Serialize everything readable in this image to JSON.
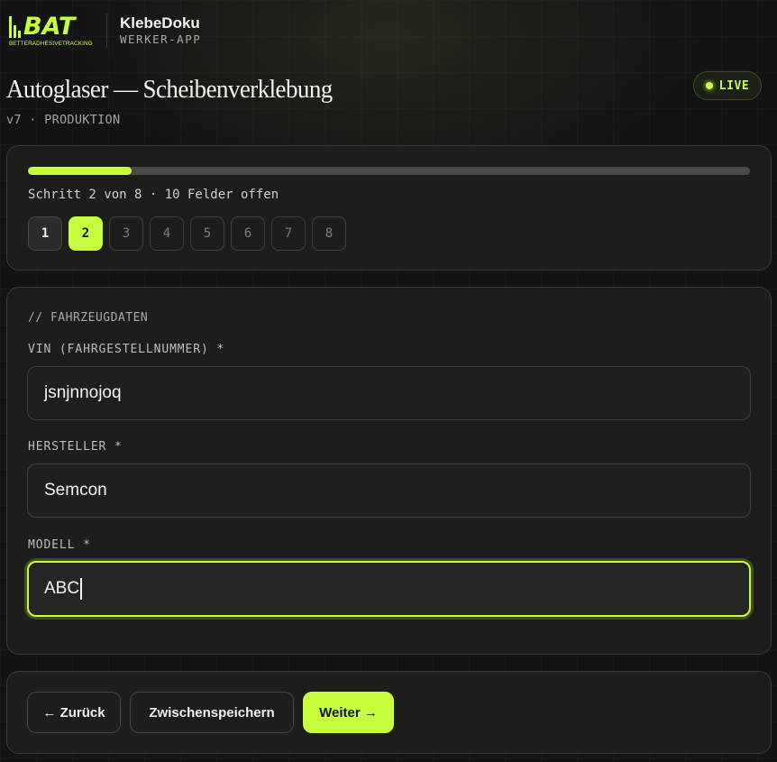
{
  "brand": {
    "logo_text": "BAT",
    "logo_tagline": "BETTERADHESIVETRACKING",
    "app_name": "KlebeDoku",
    "app_subtitle": "WERKER-APP",
    "accent_color": "#c6ff3d"
  },
  "page": {
    "title": "Autoglaser — Scheibenverklebung",
    "meta": "v7 · PRODUKTION",
    "status_badge": "LIVE"
  },
  "progress": {
    "current_step": 2,
    "total_steps": 8,
    "fraction": 0.143,
    "status_text": "Schritt 2 von 8 · 10 Felder offen",
    "steps": [
      "1",
      "2",
      "3",
      "4",
      "5",
      "6",
      "7",
      "8"
    ]
  },
  "form": {
    "section_title": "// FAHRZEUGDATEN",
    "fields": [
      {
        "label": "VIN (FAHRGESTELLNUMMER) *",
        "value": "jsnjnnojoq"
      },
      {
        "label": "HERSTELLER *",
        "value": "Semcon"
      },
      {
        "label": "MODELL *",
        "value": "ABC"
      }
    ]
  },
  "actions": {
    "back_label": "← Zurück",
    "save_label": "Zwischenspeichern",
    "next_label": "Weiter →"
  }
}
